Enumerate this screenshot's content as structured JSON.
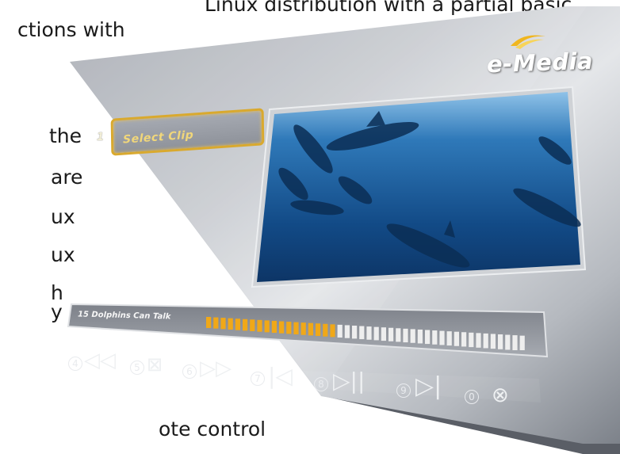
{
  "background_text": {
    "lines": [
      "Linux distribution with a partial basic",
      "ctions    with",
      "the",
      "are",
      "ux",
      "ux",
      "h",
      "y",
      "ote control"
    ]
  },
  "panel": {
    "brand": "e-Media",
    "colors": {
      "panel_light": "#dfe2e6",
      "panel_dark": "#6e737b",
      "accent_gold": "#d9a92e",
      "progress_fill": "#f0a818",
      "progress_empty": "#eeeeee",
      "video_blue": "#1b5a9a"
    },
    "step": {
      "number": "1",
      "label": "Select Clip"
    },
    "video": {
      "description_icon": "dolphins-video-frame"
    },
    "track": {
      "label": "15  Dolphins Can Talk",
      "progress": 0.4
    },
    "controls": [
      {
        "num": "4",
        "icon": "rewind-icon",
        "glyph": "◁◁"
      },
      {
        "num": "5",
        "icon": "stop-icon",
        "glyph": "⊠"
      },
      {
        "num": "6",
        "icon": "fast-forward-icon",
        "glyph": "▷▷"
      },
      {
        "num": "7",
        "icon": "previous-track-icon",
        "glyph": "|◁"
      },
      {
        "num": "8",
        "icon": "play-pause-icon",
        "glyph": "▷||"
      },
      {
        "num": "9",
        "icon": "next-track-icon",
        "glyph": "▷|"
      },
      {
        "num": "0",
        "icon": "close-icon",
        "glyph": "⊗"
      }
    ]
  }
}
